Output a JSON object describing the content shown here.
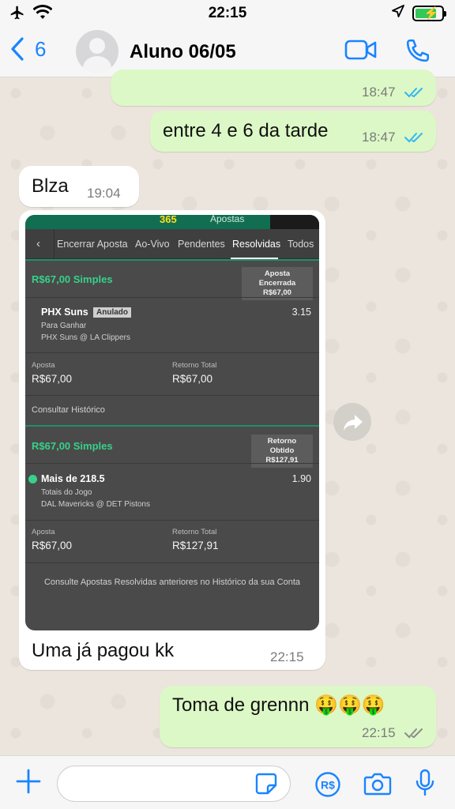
{
  "status_bar": {
    "time": "22:15"
  },
  "header": {
    "back_count": "6",
    "contact_name": "Aluno 06/05"
  },
  "messages": [
    {
      "direction": "out",
      "text": "",
      "time": "18:47",
      "read": true
    },
    {
      "direction": "out",
      "text": "entre 4 e 6 da tarde",
      "time": "18:47",
      "read": true
    },
    {
      "direction": "in",
      "text": "Blza",
      "time": "19:04"
    },
    {
      "direction": "in",
      "text": "Uma já pagou kk",
      "time": "22:15",
      "has_image": true
    },
    {
      "direction": "out",
      "text": "Toma de grennn 🤑🤑🤑",
      "time": "22:15",
      "read": false
    }
  ],
  "screenshot": {
    "logo": "365",
    "top_tab": "Apostas",
    "tabs": [
      "Encerrar Aposta",
      "Ao-Vivo",
      "Pendentes",
      "Resolvidas",
      "Todos"
    ],
    "active_tab": "Resolvidas",
    "bets": [
      {
        "title": "R$67,00 Simples",
        "badge_line1": "Aposta Encerrada",
        "badge_line2": "R$67,00",
        "selection": "PHX Suns",
        "status_tag": "Anulado",
        "odds": "3.15",
        "market": "Para Ganhar",
        "event": "PHX Suns @ LA Clippers",
        "stake_label": "Aposta",
        "stake": "R$67,00",
        "return_label": "Retorno Total",
        "return": "R$67,00",
        "history_link": "Consultar Histórico"
      },
      {
        "title": "R$67,00 Simples",
        "badge_line1": "Retorno Obtido",
        "badge_line2": "R$127,91",
        "selection": "Mais de 218.5",
        "odds": "1.90",
        "market": "Totais do Jogo",
        "event": "DAL Mavericks @ DET Pistons",
        "stake_label": "Aposta",
        "stake": "R$67,00",
        "return_label": "Retorno Total",
        "return": "R$127,91"
      }
    ],
    "footer_note": "Consulte Apostas Resolvidas anteriores no Histórico da sua Conta"
  },
  "input": {
    "value": "",
    "placeholder": ""
  },
  "colors": {
    "accent": "#1a84ff",
    "outgoing_bubble": "#dcf8c6",
    "read_ticks": "#34b7f1",
    "bet_green": "#36d18a"
  }
}
